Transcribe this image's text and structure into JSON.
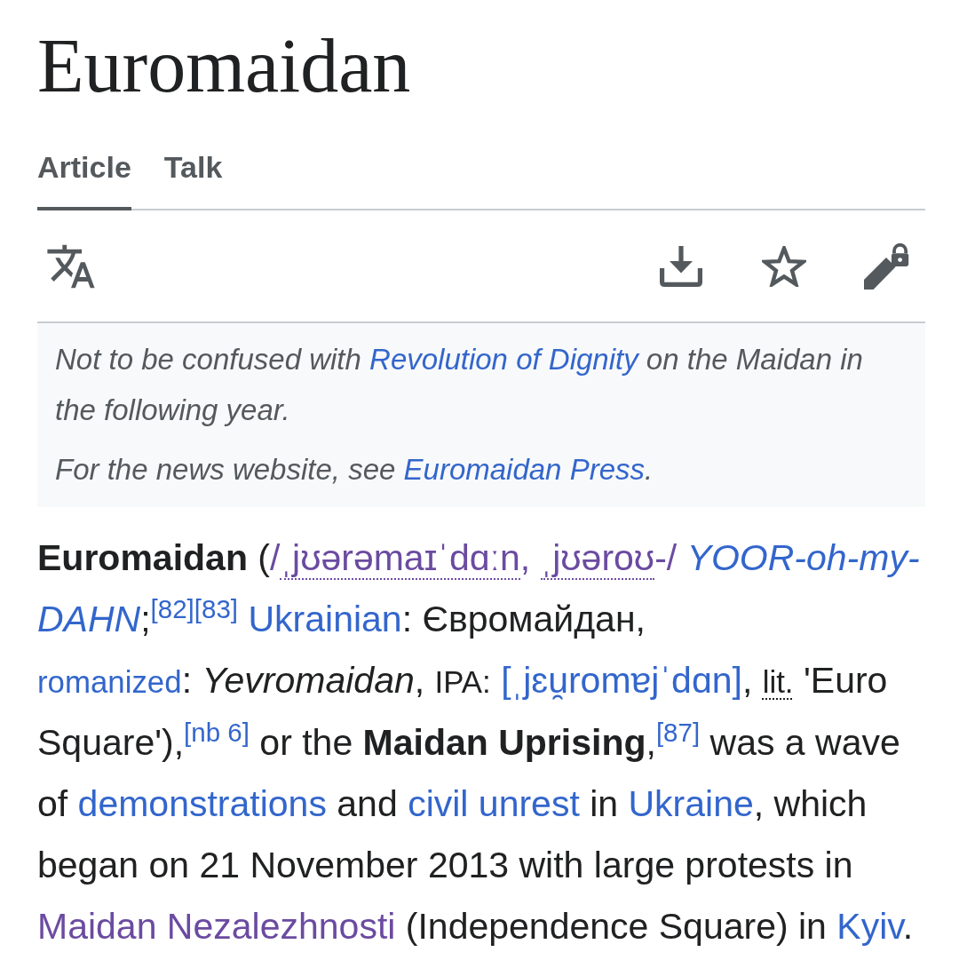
{
  "title": "Euromaidan",
  "tabs": [
    {
      "label": "Article",
      "selected": true
    },
    {
      "label": "Talk",
      "selected": false
    }
  ],
  "toolbar": {
    "watched": false,
    "protected": true
  },
  "hatnotes": [
    {
      "segments": [
        {
          "kind": "text",
          "text": "Not to be confused with "
        },
        {
          "kind": "link",
          "text": "Revolution of Dignity",
          "visited": false
        },
        {
          "kind": "text",
          "text": " on the Maidan in the following year."
        }
      ]
    },
    {
      "segments": [
        {
          "kind": "text",
          "text": "For the news website, see "
        },
        {
          "kind": "link",
          "text": "Euromaidan Press",
          "visited": false
        },
        {
          "kind": "text",
          "text": "."
        }
      ]
    }
  ],
  "paragraph": {
    "segments": [
      {
        "kind": "bold",
        "text": "Euromaidan"
      },
      {
        "kind": "text",
        "text": " ("
      },
      {
        "kind": "ipa",
        "visited": true,
        "parts": [
          {
            "text": "/",
            "dotted": false
          },
          {
            "text": "ˌjʊərəmaɪˈdɑːn",
            "dotted": true
          },
          {
            "text": ",",
            "dotted": false
          },
          {
            "text": "ˌjʊəroʊ",
            "dotted": true
          },
          {
            "text": "-/",
            "dotted": false
          }
        ]
      },
      {
        "kind": "space"
      },
      {
        "kind": "italic-link",
        "text": "YOOR-oh-my-",
        "visited": false
      },
      {
        "kind": "italic-link",
        "text": "DAHN",
        "visited": false
      },
      {
        "kind": "text",
        "text": ";"
      },
      {
        "kind": "ref",
        "text": "[82]",
        "visited": false
      },
      {
        "kind": "ref",
        "text": "[83]",
        "visited": false
      },
      {
        "kind": "space"
      },
      {
        "kind": "link",
        "text": "Ukrainian",
        "visited": false
      },
      {
        "kind": "text",
        "text": ": Євромайдан, "
      },
      {
        "kind": "small-link",
        "text": "romanized",
        "visited": false
      },
      {
        "kind": "text",
        "text": ": "
      },
      {
        "kind": "italic",
        "text": "Yevromaidan"
      },
      {
        "kind": "text",
        "text": ", "
      },
      {
        "kind": "small",
        "text": "IPA:"
      },
      {
        "kind": "space"
      },
      {
        "kind": "ipa",
        "visited": false,
        "parts": [
          {
            "text": "[ˌjɛu̯romɐjˈdɑn]",
            "dotted": false
          }
        ]
      },
      {
        "kind": "text",
        "text": ", "
      },
      {
        "kind": "abbr",
        "text": "lit."
      },
      {
        "kind": "text",
        "text": " 'Euro Square'),"
      },
      {
        "kind": "ref",
        "text": "[nb 6]",
        "visited": false
      },
      {
        "kind": "text",
        "text": " or the "
      },
      {
        "kind": "bold",
        "text": "Maidan Uprising"
      },
      {
        "kind": "text",
        "text": ","
      },
      {
        "kind": "ref",
        "text": "[87]",
        "visited": false
      },
      {
        "kind": "text",
        "text": " was a wave of "
      },
      {
        "kind": "link",
        "text": "demonstrations",
        "visited": false
      },
      {
        "kind": "text",
        "text": " and "
      },
      {
        "kind": "link",
        "text": "civil unrest",
        "visited": false
      },
      {
        "kind": "text",
        "text": " in "
      },
      {
        "kind": "link",
        "text": "Ukraine",
        "visited": false
      },
      {
        "kind": "text",
        "text": ", which began on 21 November 2013 with large protests in "
      },
      {
        "kind": "link",
        "text": "Maidan Nezalezhnosti",
        "visited": true
      },
      {
        "kind": "text",
        "text": " (Independence Square) in "
      },
      {
        "kind": "link",
        "text": "Kyiv",
        "visited": false
      },
      {
        "kind": "text",
        "text": "."
      }
    ]
  }
}
